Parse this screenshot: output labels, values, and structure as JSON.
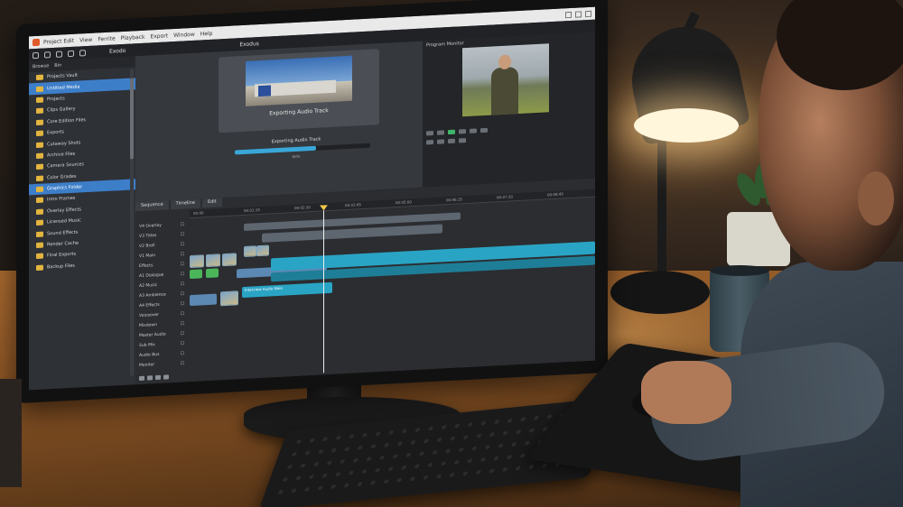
{
  "app": {
    "menu": [
      "Project Edit",
      "View",
      "Ferrite",
      "Playback",
      "Export",
      "Window",
      "Help"
    ],
    "toolbar_title": "Exodo",
    "center_tab": "Exodus"
  },
  "sidebar": {
    "header": [
      "Browse",
      "Bin"
    ],
    "items": [
      {
        "label": "Projects Vault",
        "selected": false
      },
      {
        "label": "Untitled Media",
        "selected": true
      },
      {
        "label": "Projects",
        "selected": false
      },
      {
        "label": "Clips Gallery",
        "selected": false
      },
      {
        "label": "Core Edition Files",
        "selected": false
      },
      {
        "label": "Exports",
        "selected": false
      },
      {
        "label": "Cutaway Shots",
        "selected": false
      },
      {
        "label": "Archive Files",
        "selected": false
      },
      {
        "label": "Camera Sources",
        "selected": false
      },
      {
        "label": "Color Grades",
        "selected": false
      },
      {
        "label": "Graphics Folder",
        "selected": true
      },
      {
        "label": "Intro Frames",
        "selected": false
      },
      {
        "label": "Overlay Effects",
        "selected": false
      },
      {
        "label": "Licensed Music",
        "selected": false
      },
      {
        "label": "Sound Effects",
        "selected": false
      },
      {
        "label": "Render Cache",
        "selected": false
      },
      {
        "label": "Final Exports",
        "selected": false
      },
      {
        "label": "Backup Files",
        "selected": false
      }
    ]
  },
  "export": {
    "title": "Exporting Audio Track",
    "status": "Exporting Audio Track",
    "progress": 0.6,
    "percent_text": "60%"
  },
  "viewer": {
    "title": "Program Monitor"
  },
  "timeline": {
    "tabs": [
      "Sequence",
      "Timeline",
      "Edit"
    ],
    "ruler": [
      "00:00",
      "00:01:15",
      "00:02:30",
      "00:03:45",
      "00:05:00",
      "00:06:15",
      "00:07:30",
      "00:08:45"
    ],
    "tracks": [
      "V4 Overlay",
      "V3 Titles",
      "V2 Broll",
      "V1 Main",
      "Effects",
      "A1 Dialogue",
      "A2 Music",
      "A3 Ambience",
      "A4 Effects",
      "Voiceover",
      "Mixdown",
      "Master Audio",
      "Sub Mix",
      "Audio Bus",
      "Monitor"
    ],
    "clip_label": "Interview Audio Main"
  },
  "colors": {
    "accent": "#3d7ec9",
    "progress": "#3aa7d8",
    "playhead": "#f2c94c"
  }
}
